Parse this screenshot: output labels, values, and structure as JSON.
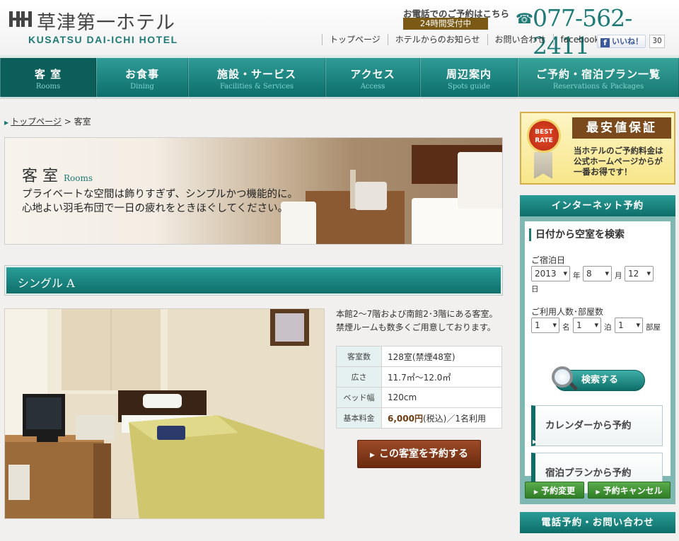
{
  "header": {
    "logo_jp": "草津第一ホテル",
    "logo_en": "KUSATSU DAI-ICHI HOTEL",
    "phone_note": "お電話でのご予約はこちら",
    "phone_badge": "24時間受付中",
    "phone_number": "077-562-2411",
    "util_links": [
      "トップページ",
      "ホテルからのお知らせ",
      "お問い合わせ",
      "facebook"
    ],
    "like_label": "いいね！",
    "like_count": "30"
  },
  "nav": [
    {
      "jp": "客 室",
      "en": "Rooms"
    },
    {
      "jp": "お食事",
      "en": "Dining"
    },
    {
      "jp": "施設・サービス",
      "en": "Facilities & Services"
    },
    {
      "jp": "アクセス",
      "en": "Access"
    },
    {
      "jp": "周辺案内",
      "en": "Spots guide"
    },
    {
      "jp": "ご予約・宿泊プラン一覧",
      "en": "Reservations & Packages"
    }
  ],
  "breadcrumb": {
    "home": "トップページ",
    "current": "客室"
  },
  "hero": {
    "title": "客 室",
    "title_en": "Rooms",
    "line1": "プライベートな空間は飾りすぎず、シンプルかつ機能的に。",
    "line2": "心地よい羽毛布団で一日の疲れをときほぐしてください。"
  },
  "room": {
    "name": "シングル A",
    "desc1": "本館2～7階および南館2･3階にある客室。",
    "desc2": "禁煙ルームも数多くご用意しております。",
    "specs": [
      {
        "key": "客室数",
        "val": "128室(禁煙48室)"
      },
      {
        "key": "広さ",
        "val": "11.7㎡～12.0㎡"
      },
      {
        "key": "ベッド幅",
        "val": "120cm"
      },
      {
        "key": "基本料金",
        "price": "6,000円",
        "suffix": "(税込)／1名利用"
      }
    ],
    "book_label": "この客室を予約する"
  },
  "best_rate": {
    "medal": "BEST RATE",
    "title": "最安値保証",
    "line1": "当ホテルのご予約料金は",
    "line2": "公式ホームページからが",
    "line3_em": "一番お得",
    "line3_rest": "です！"
  },
  "booking": {
    "head": "インターネット予約",
    "search_title": "日付から空室を検索",
    "checkin_label": "ご宿泊日",
    "year": "2013",
    "year_unit": "年",
    "month": "8",
    "month_unit": "月",
    "day": "12",
    "day_unit": "日",
    "guests_label": "ご利用人数･部屋数",
    "guests": "1",
    "guests_unit": "名",
    "nights": "1",
    "nights_unit": "泊",
    "rooms": "1",
    "rooms_unit": "部屋",
    "search_btn": "検索する",
    "calendar_btn": "カレンダーから予約",
    "plan_btn": "宿泊プランから予約",
    "change_btn": "予約変更",
    "cancel_btn": "予約キャンセル"
  },
  "phone_panel": "電話予約・お問い合わせ"
}
